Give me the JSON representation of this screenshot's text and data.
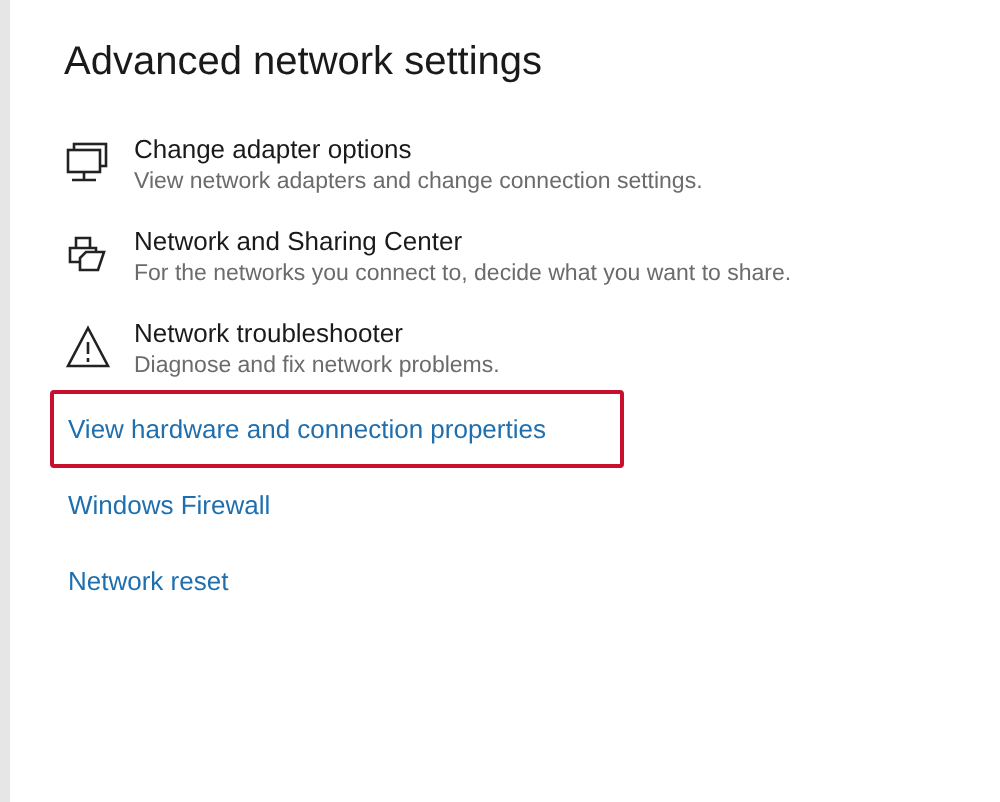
{
  "title": "Advanced network settings",
  "options": [
    {
      "kind": "adapter",
      "title": "Change adapter options",
      "description": "View network adapters and change connection settings."
    },
    {
      "kind": "sharing",
      "title": "Network and Sharing Center",
      "description": "For the networks you connect to, decide what you want to share."
    },
    {
      "kind": "troubleshooter",
      "title": "Network troubleshooter",
      "description": "Diagnose and fix network problems."
    }
  ],
  "links": [
    {
      "label": "View hardware and connection properties",
      "highlighted": true
    },
    {
      "label": "Windows Firewall",
      "highlighted": false
    },
    {
      "label": "Network reset",
      "highlighted": false
    }
  ]
}
